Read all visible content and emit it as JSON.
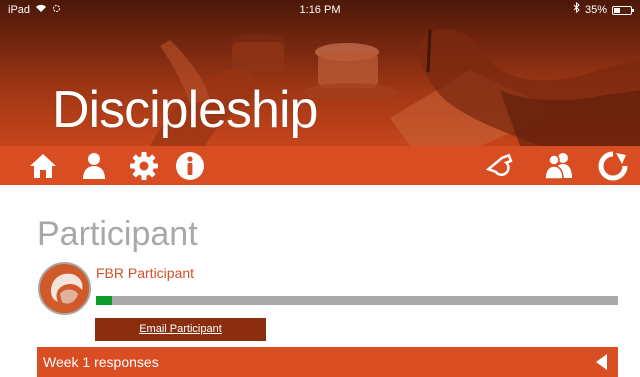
{
  "status_bar": {
    "device": "iPad",
    "time": "1:16 PM",
    "battery": "35%",
    "battery_level": 0.35
  },
  "header": {
    "app_title": "Discipleship"
  },
  "nav": {
    "left_icons": [
      "home-icon",
      "profile-icon",
      "settings-gear-icon",
      "info-icon"
    ],
    "right_icons": [
      "whistle-icon",
      "group-icon",
      "refresh-icon"
    ]
  },
  "main": {
    "page_title": "Participant",
    "participant_name": "FBR Participant",
    "progress_fraction": 0.03,
    "email_button_label": "Email Participant",
    "week_section_label": "Week 1 responses"
  },
  "colors": {
    "accent": "#d84d21",
    "email_button": "#8b2e10",
    "progress": "#0e9a2a"
  }
}
